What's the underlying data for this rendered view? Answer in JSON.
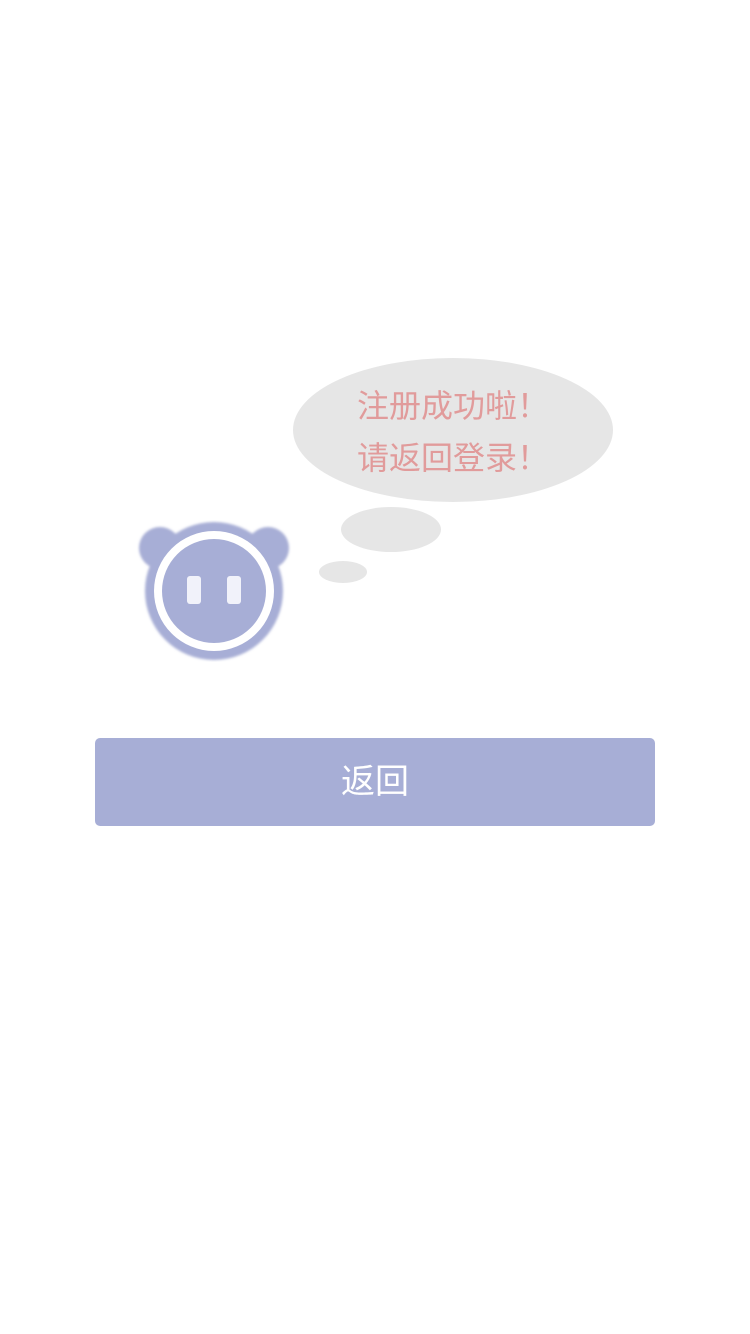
{
  "message": {
    "line1": "注册成功啦！",
    "line2": "请返回登录！"
  },
  "back_button": {
    "label": "返回"
  },
  "mascot": {
    "icon": "mascot-icon",
    "color": "#a7aed6"
  },
  "colors": {
    "bubble": "#e6e6e6",
    "message_text": "#e19b9b",
    "button_bg": "#a7aed6",
    "button_text": "#ffffff",
    "background": "#ffffff"
  }
}
